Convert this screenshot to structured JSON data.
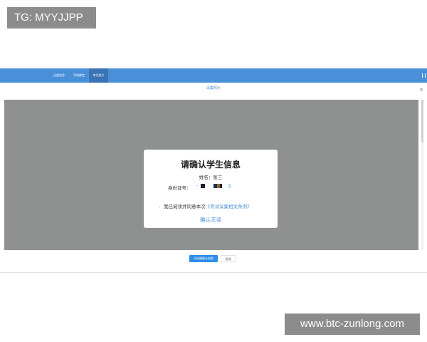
{
  "watermarks": {
    "top_left": "TG: MYYJJPP",
    "bottom_right": "www.btc-zunlong.com"
  },
  "topbar": {
    "color": "#4a90d9",
    "tabs": [
      {
        "label": "注册信息"
      },
      {
        "label": "手机绑定"
      },
      {
        "label": "考生照片",
        "active": true
      }
    ]
  },
  "modal": {
    "title": "采集照片",
    "close_icon": "×"
  },
  "dialog": {
    "title": "请确认学生信息",
    "name_label": "姓名：",
    "name_value": "张三",
    "id_label": "身份证号：",
    "agree_check": "✓",
    "agree_text": "我已阅读并同意本次",
    "agree_link": "《考试采集相关条例》",
    "confirm_label": "确认无误"
  },
  "footer": {
    "primary_label": "开启摄像头拍照",
    "cancel_label": "取消"
  }
}
